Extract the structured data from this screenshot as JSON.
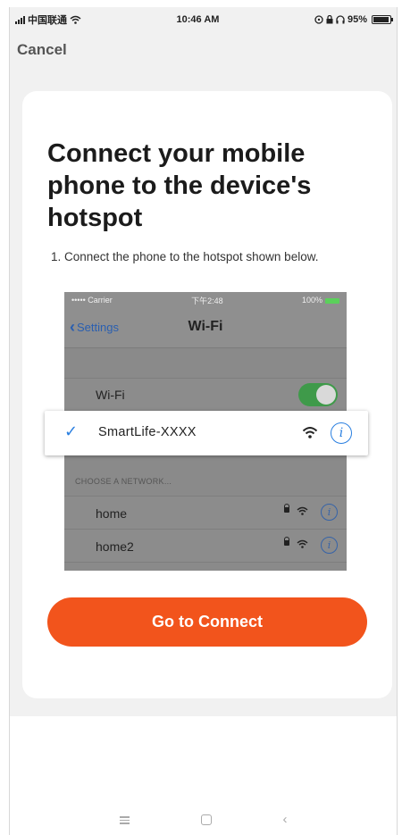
{
  "status_bar": {
    "carrier": "中国联通",
    "time": "10:46 AM",
    "battery_percent": "95%",
    "battery_level": 0.95,
    "icons": [
      "signal-icon",
      "wifi-icon",
      "alarm-icon",
      "lock-rotation-icon",
      "headphones-icon",
      "battery-icon"
    ]
  },
  "header": {
    "cancel_label": "Cancel"
  },
  "card": {
    "title": "Connect your mobile phone to the device's hotspot",
    "instruction": "1. Connect the phone to the hotspot shown below.",
    "connect_button": "Go to Connect"
  },
  "wifi_screenshot": {
    "status_left": "••••• Carrier",
    "status_time": "下午2:48",
    "status_battery": "100%",
    "back_label": "Settings",
    "nav_title": "Wi-Fi",
    "wifi_toggle_label": "Wi-Fi",
    "wifi_toggle_on": true,
    "selected_network": "SmartLife-XXXX",
    "choose_label": "CHOOSE A NETWORK...",
    "networks": [
      {
        "name": "home"
      },
      {
        "name": "home2"
      }
    ]
  },
  "colors": {
    "accent": "#f2541c",
    "link_blue": "#2a7fe0",
    "toggle_green": "#3f9a4a",
    "background": "#f1f1f1"
  },
  "system_nav": {
    "icons": [
      "menu-icon",
      "home-icon",
      "back-icon"
    ]
  }
}
